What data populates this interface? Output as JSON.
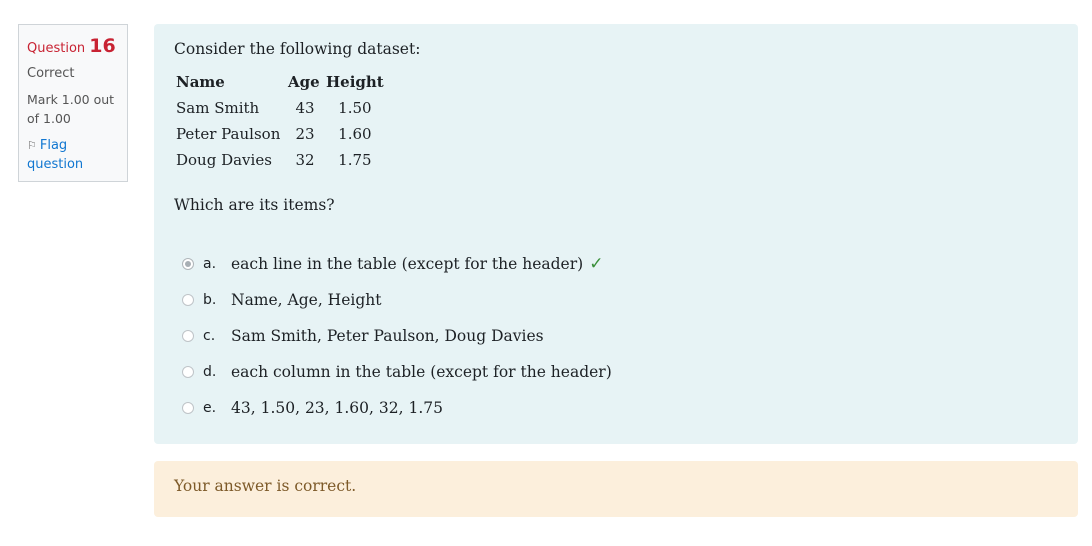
{
  "info": {
    "question_label": "Question",
    "question_number": "16",
    "state": "Correct",
    "grade": "Mark 1.00 out of 1.00",
    "flag_label": "Flag question"
  },
  "question": {
    "intro": "Consider the following dataset:",
    "table": {
      "headers": [
        "Name",
        "Age",
        "Height"
      ],
      "rows": [
        [
          "Sam Smith",
          "43",
          "1.50"
        ],
        [
          "Peter Paulson",
          "23",
          "1.60"
        ],
        [
          "Doug Davies",
          "32",
          "1.75"
        ]
      ]
    },
    "prompt": "Which are its items?",
    "answers": [
      {
        "letter": "a.",
        "text": "each line in the table (except for the header)",
        "selected": true,
        "correct": true
      },
      {
        "letter": "b.",
        "text": "Name, Age, Height",
        "selected": false
      },
      {
        "letter": "c.",
        "text": "Sam Smith, Peter Paulson, Doug Davies",
        "selected": false
      },
      {
        "letter": "d.",
        "text": "each column in the table (except for the header)",
        "selected": false
      },
      {
        "letter": "e.",
        "text": "43, 1.50, 23, 1.60, 32, 1.75",
        "selected": false
      }
    ]
  },
  "feedback": {
    "text": "Your answer is correct."
  },
  "colors": {
    "question_number": "#c82333",
    "formulation_bg": "#e7f3f5",
    "outcome_bg": "#fcefdc",
    "correct_check": "#3a8f3a",
    "link": "#1177d1"
  }
}
